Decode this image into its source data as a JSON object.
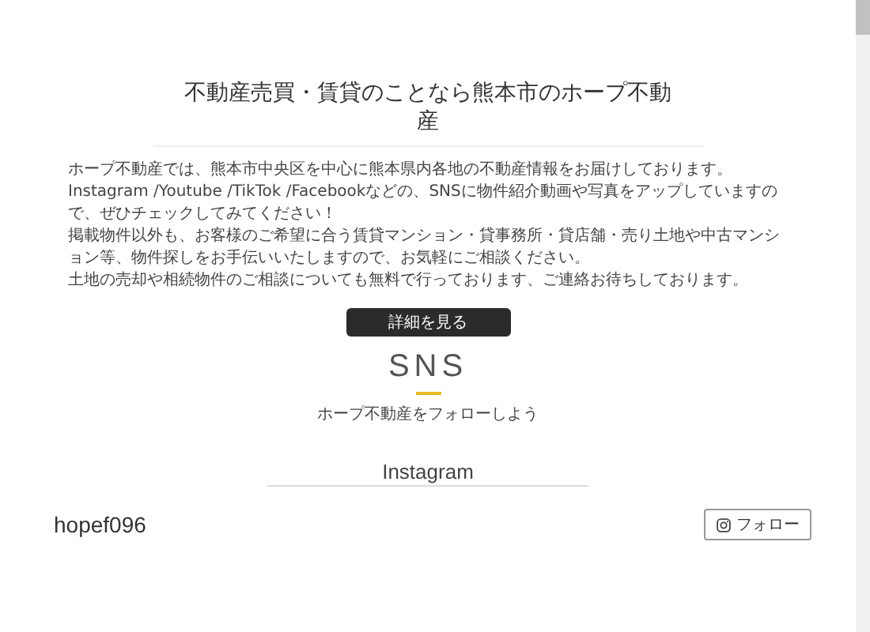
{
  "heading": "不動産売買・賃貸のことなら熊本市のホープ不動産",
  "paragraphs": [
    "ホープ不動産では、熊本市中央区を中心に熊本県内各地の不動産情報をお届けしております。",
    "Instagram /Youtube /TikTok /Facebookなどの、SNSに物件紹介動画や写真をアップしていますので、ぜひチェックしてみてください！",
    "掲載物件以外も、お客様のご希望に合う賃貸マンション・貸事務所・貸店舗・売り土地や中古マンション等、物件探しをお手伝いいたしますので、お気軽にご相談ください。",
    "土地の売却や相続物件のご相談についても無料で行っております、ご連絡お待ちしております。"
  ],
  "detail_button": "詳細を見る",
  "sns": {
    "title": "SNS",
    "subtitle": "ホープ不動産をフォローしよう",
    "platform": "Instagram"
  },
  "account": {
    "handle": "hopef096",
    "follow_button": "フォロー"
  }
}
